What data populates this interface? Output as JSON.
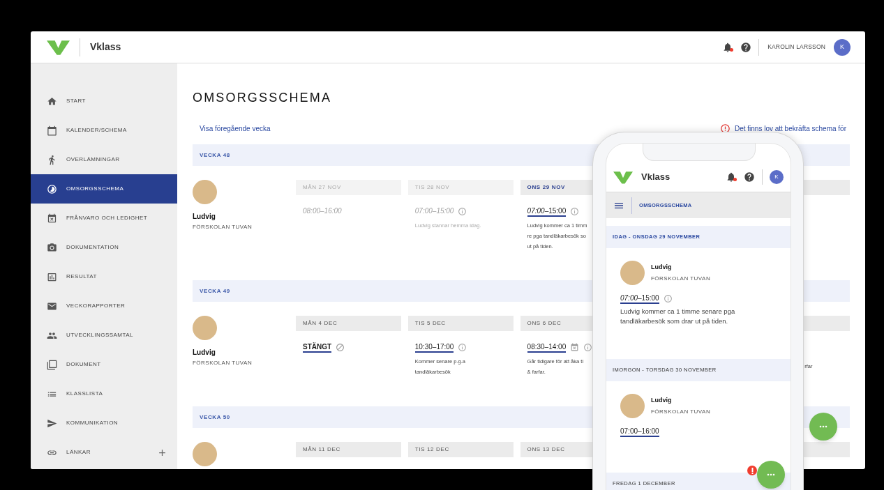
{
  "header": {
    "logo_text": "Vklass",
    "has_notifications": true,
    "user_name": "KAROLIN LARSSON",
    "avatar_initial": "K"
  },
  "sidebar": {
    "items": [
      {
        "label": "START",
        "selected": false,
        "kind": "page"
      },
      {
        "label": "KALENDER/SCHEMA",
        "selected": false,
        "kind": "page"
      },
      {
        "label": "ÖVERLÄMNINGAR",
        "selected": false,
        "kind": "page"
      },
      {
        "label": "OMSORGSSCHEMA",
        "selected": true,
        "kind": "page"
      },
      {
        "label": "FRÅNVARO OCH LEDIGHET",
        "selected": false,
        "kind": "page"
      },
      {
        "label": "DOKUMENTATION",
        "selected": false,
        "kind": "page"
      },
      {
        "label": "RESULTAT",
        "selected": false,
        "kind": "page"
      },
      {
        "label": "VECKORAPPORTER",
        "selected": false,
        "kind": "page"
      },
      {
        "label": "UTVECKLINGSSAMTAL",
        "selected": false,
        "kind": "page"
      },
      {
        "label": "DOKUMENT",
        "selected": false,
        "kind": "page"
      },
      {
        "label": "KLASSLISTA",
        "selected": false,
        "kind": "page"
      },
      {
        "label": "KOMMUNIKATION",
        "selected": false,
        "kind": "page"
      },
      {
        "label": "LÄNKAR",
        "selected": false,
        "kind": "group"
      }
    ]
  },
  "main": {
    "title": "OMSORGSSCHEMA",
    "previous_week_link": "Visa föregående vecka",
    "notice": "Det finns lov att bekräfta schema för",
    "weeks": [
      {
        "label": "VECKA 48",
        "child": {
          "name": "Ludvig",
          "school": "FÖRSKOLAN TUVAN"
        },
        "days": [
          {
            "header": "MÅN 27 NOV",
            "past": true,
            "today": false,
            "kind": "time",
            "time": "08:00–16:00",
            "underlined": false,
            "info": false,
            "absence": false
          },
          {
            "header": "TIS 28 NOV",
            "past": true,
            "today": false,
            "kind": "time",
            "time": "07:00–15:00",
            "underlined": false,
            "info": true,
            "absence": false,
            "note_lines": [
              "Ludvig stannar hemma idag."
            ]
          },
          {
            "header": "ONS 29 NOV",
            "past": false,
            "today": true,
            "kind": "time",
            "time": "*07:00*–15:00",
            "underlined": true,
            "info": true,
            "absence": false,
            "note_lines": [
              "Ludvig kommer ca 1 timm",
              "re pga tandläkarbesök so",
              "ut på tiden."
            ]
          },
          {
            "kind": "hidden"
          },
          {
            "kind": "hidden"
          }
        ]
      },
      {
        "label": "VECKA 49",
        "child": {
          "name": "Ludvig",
          "school": "FÖRSKOLAN TUVAN"
        },
        "days": [
          {
            "header": "MÅN 4 DEC",
            "past": false,
            "today": false,
            "kind": "closed",
            "time": "STÄNGT",
            "underlined": true
          },
          {
            "header": "TIS 5 DEC",
            "past": false,
            "today": false,
            "kind": "time",
            "time": "10:30–17:00",
            "underlined": true,
            "info": true,
            "absence": false,
            "note_lines": [
              "Kommer senare p.g.a",
              "tandläkarbesök"
            ]
          },
          {
            "header": "ONS 6 DEC",
            "past": false,
            "today": false,
            "kind": "time",
            "time": "08:30–14:00",
            "underlined": true,
            "info": true,
            "absence": true,
            "note_lines": [
              "Går tidigare för att åka ti",
              "& farfar."
            ]
          },
          {
            "kind": "hidden"
          },
          {
            "kind": "hidden",
            "note_lines": [
              "rfar"
            ]
          }
        ]
      },
      {
        "label": "VECKA 50",
        "days": [
          {
            "header": "MÅN 11 DEC",
            "past": false,
            "today": false,
            "kind": "time"
          },
          {
            "header": "TIS 12 DEC",
            "past": false,
            "today": false,
            "kind": "time"
          },
          {
            "header": "ONS 13 DEC",
            "past": false,
            "today": false,
            "kind": "time"
          },
          {
            "kind": "hidden"
          },
          {
            "kind": "hidden"
          }
        ]
      }
    ]
  },
  "phone": {
    "logo_text": "Vklass",
    "has_notifications": true,
    "avatar_initial": "K",
    "page_title": "OMSORGSSCHEMA",
    "fab_alert": true,
    "days": [
      {
        "label": "IDAG - ONSDAG 29 NOVEMBER",
        "today": true,
        "entries": [
          {
            "name": "Ludvig",
            "school": "FÖRSKOLAN TUVAN",
            "time": "*07:00*–15:00",
            "info": true,
            "note": "Ludvig kommer ca 1 timme senare pga tandläkarbesök som drar ut på tiden."
          }
        ]
      },
      {
        "label": "IMORGON - TORSDAG 30 NOVEMBER",
        "today": false,
        "entries": [
          {
            "name": "Ludvig",
            "school": "FÖRSKOLAN TUVAN",
            "time": "07:00–16:00",
            "info": false
          }
        ]
      },
      {
        "label": "FREDAG 1 DECEMBER",
        "today": false
      }
    ]
  }
}
